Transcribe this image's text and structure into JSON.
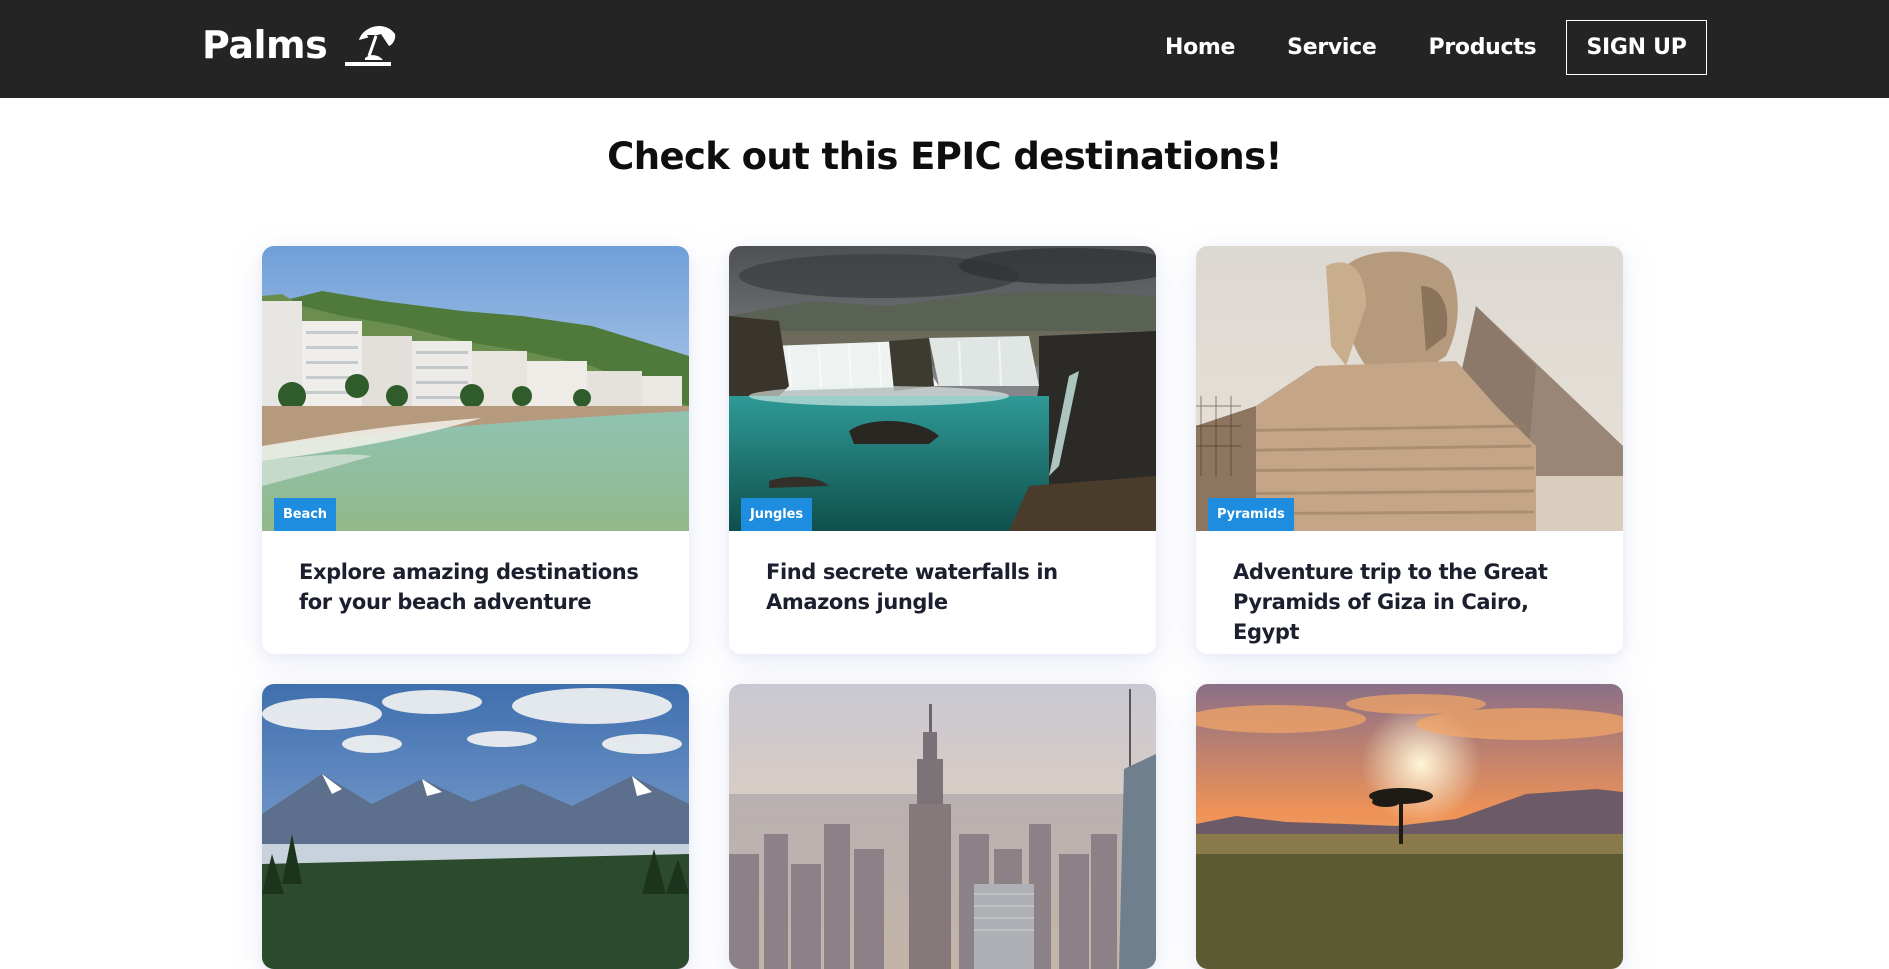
{
  "nav": {
    "brand": "Palms",
    "brand_icon": "beach-umbrella-icon",
    "links": [
      "Home",
      "Service",
      "Products"
    ],
    "signup_label": "SIGN UP"
  },
  "main": {
    "title": "Check out this EPIC destinations!",
    "cards": [
      {
        "tag": "Beach",
        "title": "Explore amazing destinations for your beach adventure",
        "image": "beach-resort-photo"
      },
      {
        "tag": "Jungles",
        "title": "Find secrete waterfalls in Amazons jungle",
        "image": "waterfall-photo"
      },
      {
        "tag": "Pyramids",
        "title": "Adventure trip to the Great Pyramids of Giza in Cairo, Egypt",
        "image": "sphinx-photo"
      },
      {
        "tag": "",
        "title": "",
        "image": "mountains-photo"
      },
      {
        "tag": "",
        "title": "",
        "image": "city-skyline-photo"
      },
      {
        "tag": "",
        "title": "",
        "image": "savanna-sunset-photo"
      }
    ]
  },
  "colors": {
    "navbar": "#242424",
    "tag": "#1e8de0",
    "card_title": "#1c1f2e"
  }
}
